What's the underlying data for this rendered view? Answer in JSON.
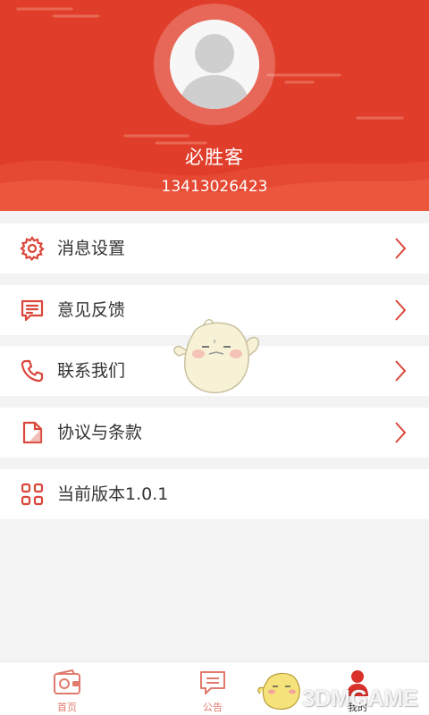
{
  "profile": {
    "username": "必胜客",
    "phone": "13413026423"
  },
  "menu": {
    "item1": {
      "label": "消息设置",
      "icon": "gear-icon"
    },
    "item2": {
      "label": "意见反馈",
      "icon": "feedback-icon"
    },
    "item3": {
      "label": "联系我们",
      "icon": "phone-icon"
    },
    "item4": {
      "label": "协议与条款",
      "icon": "document-icon"
    },
    "item5": {
      "label": "当前版本1.0.1",
      "icon": "grid-icon"
    }
  },
  "tabs": {
    "home": {
      "label": "首页",
      "icon": "wallet-icon"
    },
    "notice": {
      "label": "公告",
      "icon": "message-icon"
    },
    "mine": {
      "label": "我的",
      "icon": "person-icon"
    }
  },
  "watermark": {
    "text": "3DMGAME"
  },
  "colors": {
    "brand": "#e03e2b",
    "icon": "#d9463a",
    "background": "#f3f3f3"
  }
}
